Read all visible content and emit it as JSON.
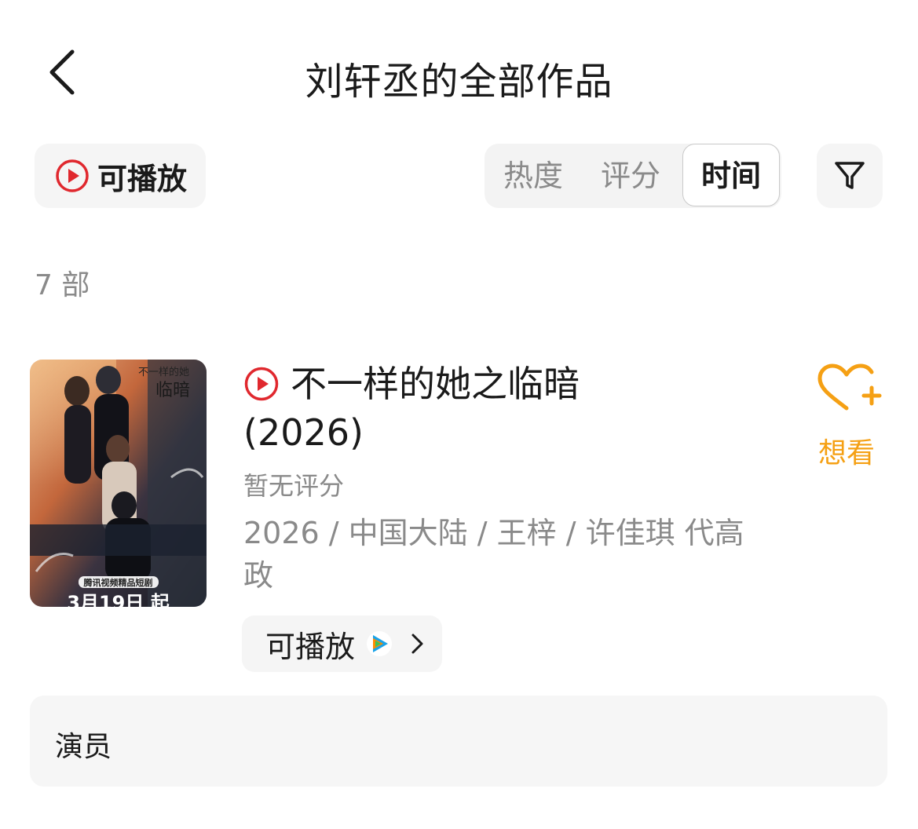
{
  "header": {
    "back_icon": "chevron-left-icon",
    "title": "刘轩丞的全部作品"
  },
  "filters": {
    "playable_label": "可播放",
    "sort_tabs": [
      {
        "label": "热度",
        "selected": false
      },
      {
        "label": "评分",
        "selected": false
      },
      {
        "label": "时间",
        "selected": true
      }
    ],
    "filter_icon": "funnel-icon"
  },
  "count_text": "7 部",
  "works": [
    {
      "title": "不一样的她之临暗",
      "year": "(2026)",
      "rating": "暂无评分",
      "meta": "2026 / 中国大陆 / 王梓 / 许佳琪 代高政",
      "want_label": "想看",
      "play_label": "可播放",
      "poster": {
        "tagline": "腾讯视频精品短剧",
        "release": "3月19日 起"
      }
    }
  ],
  "actor_section": {
    "label": "演员"
  },
  "colors": {
    "accent_red": "#e0282e",
    "want_orange": "#f5a014",
    "muted_text": "#8a8a8a",
    "chip_bg": "#f5f5f5"
  }
}
